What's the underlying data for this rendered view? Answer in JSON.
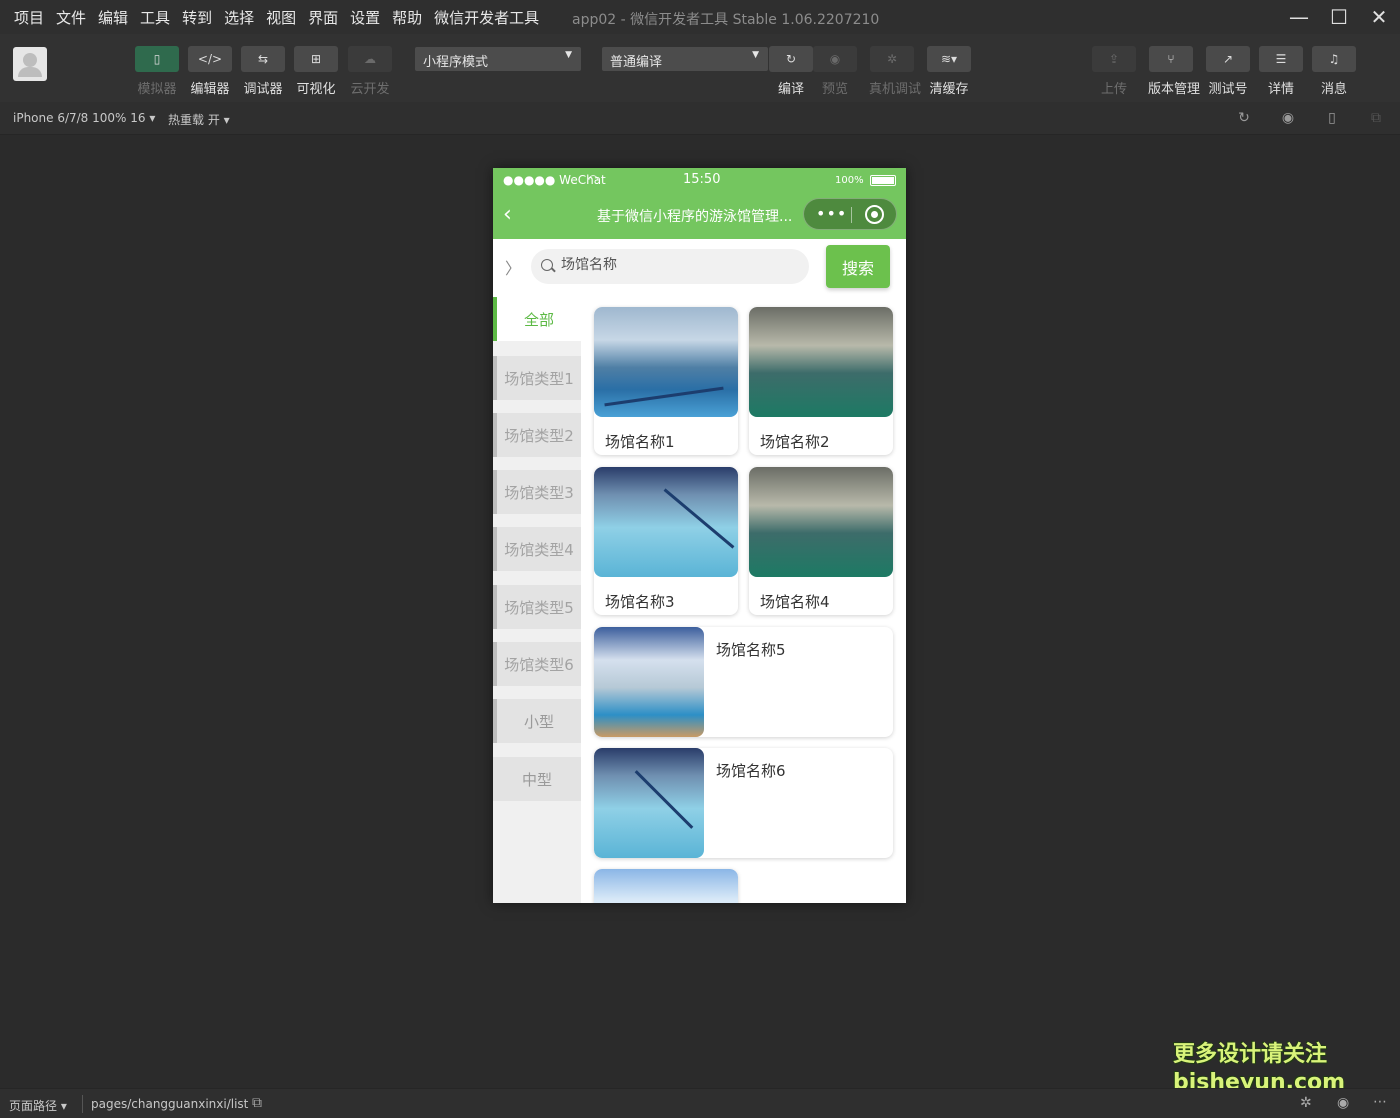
{
  "menubar": {
    "items": [
      "项目",
      "文件",
      "编辑",
      "工具",
      "转到",
      "选择",
      "视图",
      "界面",
      "设置",
      "帮助",
      "微信开发者工具"
    ],
    "window_title": "app02 - 微信开发者工具 Stable 1.06.2207210"
  },
  "toolbar": {
    "simulator": "模拟器",
    "editor": "编辑器",
    "debugger": "调试器",
    "visual": "可视化",
    "cloud": "云开发",
    "mode_select": "小程序模式",
    "compile_select": "普通编译",
    "compile": "编译",
    "preview": "预览",
    "remote_debug": "真机调试",
    "clear_cache": "清缓存",
    "upload": "上传",
    "version": "版本管理",
    "test_account": "测试号",
    "details": "详情",
    "messages": "消息"
  },
  "subbar": {
    "device": "iPhone 6/7/8 100% 16",
    "hot_reload": "热重载 开"
  },
  "phone": {
    "status": {
      "carrier": "●●●●● WeChat",
      "time": "15:50",
      "battery": "100%"
    },
    "nav_title": "基于微信小程序的游泳馆管理...",
    "search": {
      "placeholder": "场馆名称",
      "button": "搜索"
    },
    "categories": [
      "全部",
      "场馆类型1",
      "场馆类型2",
      "场馆类型3",
      "场馆类型4",
      "场馆类型5",
      "场馆类型6",
      "小型",
      "中型"
    ],
    "venues": [
      "场馆名称1",
      "场馆名称2",
      "场馆名称3",
      "场馆名称4",
      "场馆名称5",
      "场馆名称6"
    ]
  },
  "statusbar": {
    "page_path_label": "页面路径",
    "page_path": "pages/changguanxinxi/list",
    "watermark_line1": "更多设计请关注",
    "watermark_line2": "bisheyun.com"
  }
}
